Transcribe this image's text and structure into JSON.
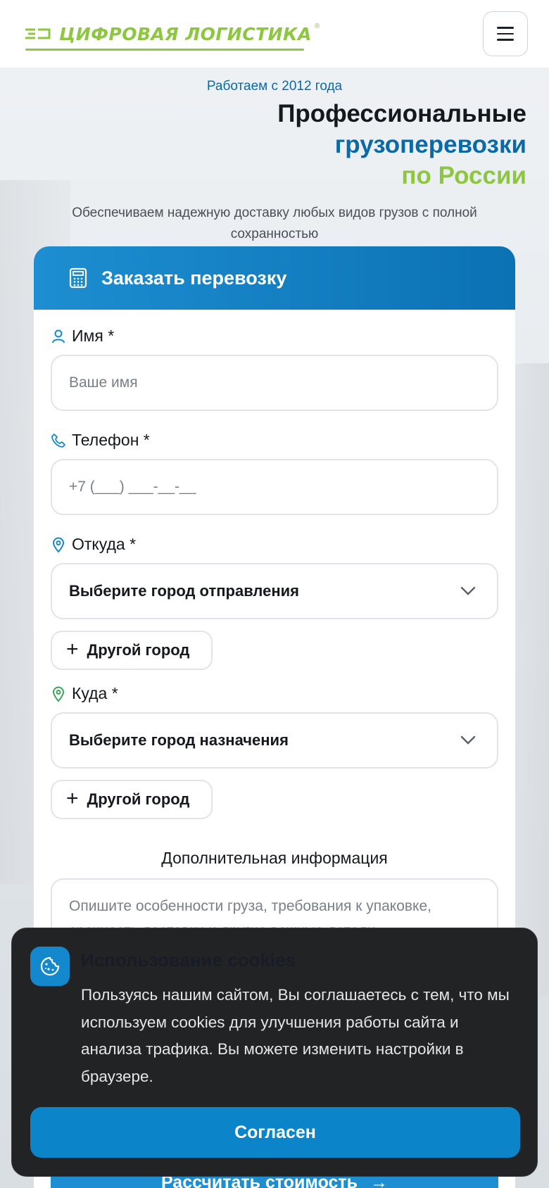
{
  "header": {
    "logo_text": "ЦИФРОВАЯ ЛОГИСТИКА",
    "logo_reg": "®",
    "menu_icon": "hamburger-icon"
  },
  "hero": {
    "since": "Работаем с 2012 года",
    "title_line1": "Профессиональные",
    "title_line2": "грузоперевозки",
    "title_line3": "по России",
    "subtitle": "Обеспечиваем надежную доставку любых видов грузов с полной сохранностью"
  },
  "form": {
    "title": "Заказать перевозку",
    "name_label": "Имя *",
    "name_placeholder": "Ваше имя",
    "phone_label": "Телефон *",
    "phone_placeholder": "+7 (___) ___-__-__",
    "from_label": "Откуда *",
    "from_select": "Выберите город отправления",
    "from_other": "Другой город",
    "to_label": "Куда *",
    "to_select": "Выберите город назначения",
    "to_other": "Другой город",
    "extra_title": "Дополнительная информация",
    "extra_placeholder": "Опишите особенности груза, требования к упаковке, срочность доставки и другие важные детали...",
    "calc_button": "Рассчитать стоимость",
    "calc_arrow": "→"
  },
  "cookie": {
    "title": "Использование cookies",
    "text": "Пользуясь нашим сайтом, Вы соглашаетесь с тем, что мы используем cookies для улучшения работы сайта и анализа трафика. Вы можете изменить настройки в браузере.",
    "accept": "Согласен"
  },
  "colors": {
    "brand_green": "#8dc63f",
    "brand_blue": "#0a6aa8",
    "button_blue": "#0b84c9",
    "cookie_bg": "#222324"
  }
}
